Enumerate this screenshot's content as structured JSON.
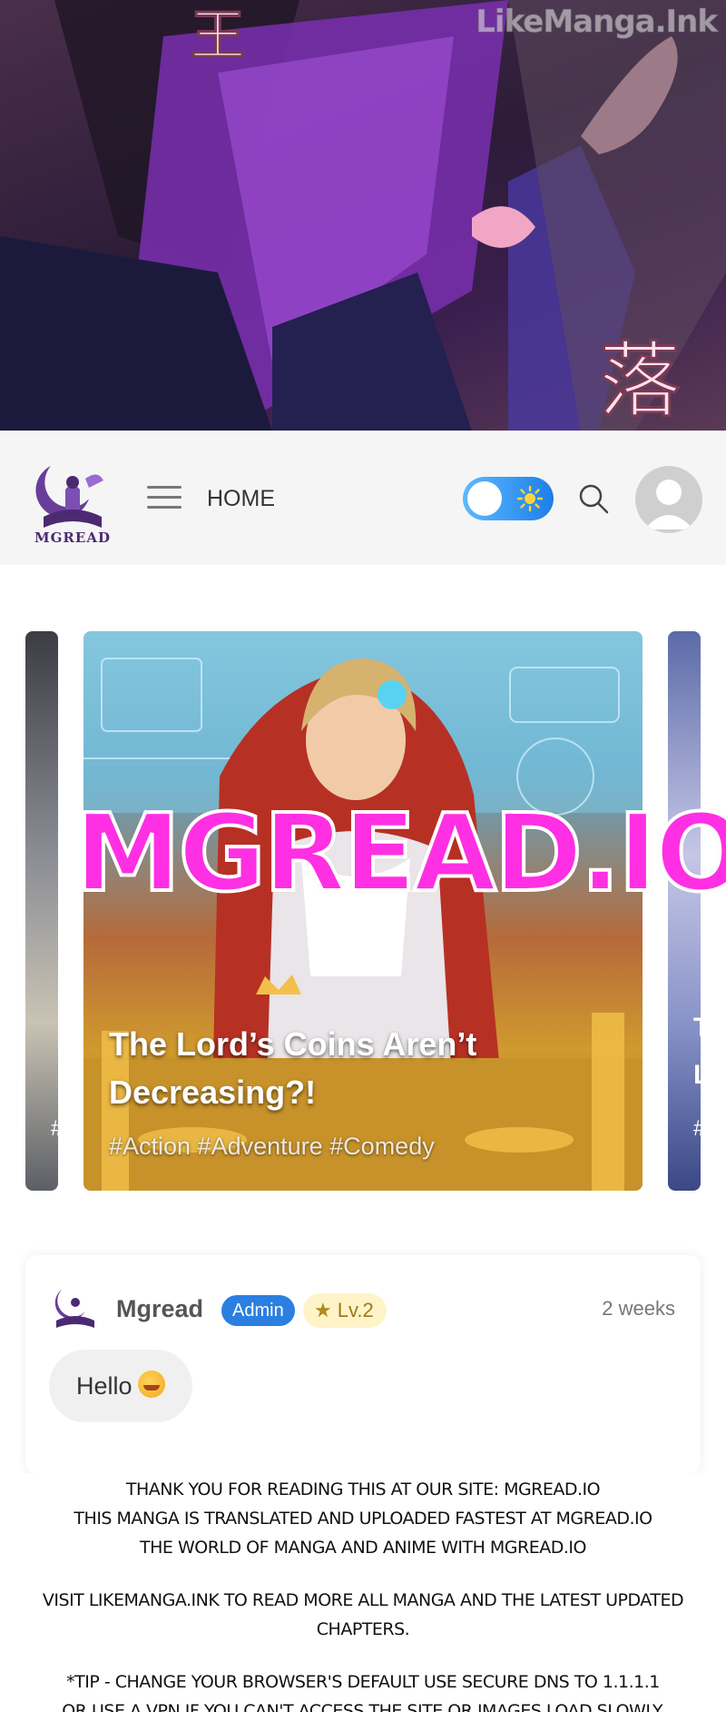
{
  "watermark": "LikeManga.Ink",
  "header": {
    "logo_text": "MGREAD",
    "home_label": "HOME"
  },
  "carousel": {
    "title_line1": "The Lord’s Coins Aren’t",
    "title_line2": "Decreasing?!",
    "tags": "#Action #Adventure #Comedy",
    "left_tag": "#",
    "right_letter_1": "T",
    "right_letter_2": "L",
    "right_tag": "#",
    "promo_text": "MGREAD.IO"
  },
  "comment": {
    "username": "Mgread",
    "badge": "Admin",
    "level": "Lv.2",
    "time": "2 weeks",
    "message": "Hello"
  },
  "notice": {
    "line1": "Thank you for reading this at our site: mgread.io",
    "line2": "This manga is translated and uploaded fastest at mgread.io",
    "line3": "The world of manga and anime with mgread.io",
    "line4": "Visit likemanga.ink to read more all manga and the latest updated chapters.",
    "line5": "*Tip - Change your browser's default use secure DNS to 1.1.1.1",
    "line6": "or use a VPN if you can't access the site or images load slowly."
  },
  "colors": {
    "promo_pink": "#ff2fe3",
    "admin_blue": "#2b7fe0",
    "toggle_blue": "#1e7fe8",
    "logo_purple": "#4c2a72"
  }
}
